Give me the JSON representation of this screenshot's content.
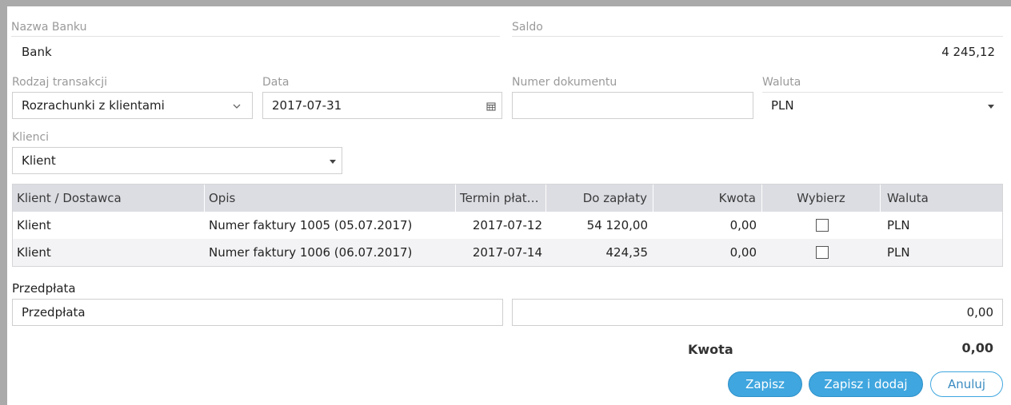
{
  "bank": {
    "label": "Nazwa Banku",
    "value": "Bank"
  },
  "balance": {
    "label": "Saldo",
    "value": "4 245,12"
  },
  "transaction_type": {
    "label": "Rodzaj transakcji",
    "value": "Rozrachunki z klientami",
    "icon": "chevron-down-icon"
  },
  "date": {
    "label": "Data",
    "value": "2017-07-31",
    "icon": "calendar-icon"
  },
  "document_number": {
    "label": "Numer dokumentu",
    "value": ""
  },
  "currency": {
    "label": "Waluta",
    "value": "PLN",
    "icon": "caret-down-icon"
  },
  "clients": {
    "label": "Klienci",
    "value": "Klient",
    "icon": "caret-down-icon"
  },
  "table": {
    "columns": [
      "Klient / Dostawca",
      "Opis",
      "Termin płat…",
      "Do zapłaty",
      "Kwota",
      "Wybierz",
      "Waluta"
    ],
    "rows": [
      {
        "client": "Klient",
        "description": "Numer faktury 1005 (05.07.2017)",
        "due": "2017-07-12",
        "to_pay": "54 120,00",
        "amount": "0,00",
        "selected": false,
        "currency": "PLN"
      },
      {
        "client": "Klient",
        "description": "Numer faktury 1006 (06.07.2017)",
        "due": "2017-07-14",
        "to_pay": "424,35",
        "amount": "0,00",
        "selected": false,
        "currency": "PLN"
      }
    ]
  },
  "prepayment": {
    "label": "Przedpłata",
    "text_value": "Przedpłata",
    "amount_value": "0,00"
  },
  "total": {
    "label": "Kwota",
    "value": "0,00"
  },
  "buttons": {
    "save": "Zapisz",
    "save_add": "Zapisz i dodaj",
    "cancel": "Anuluj"
  },
  "colors": {
    "accent": "#3fa6df",
    "table_header": "#dcdde3",
    "frame": "#aaaaaa"
  }
}
